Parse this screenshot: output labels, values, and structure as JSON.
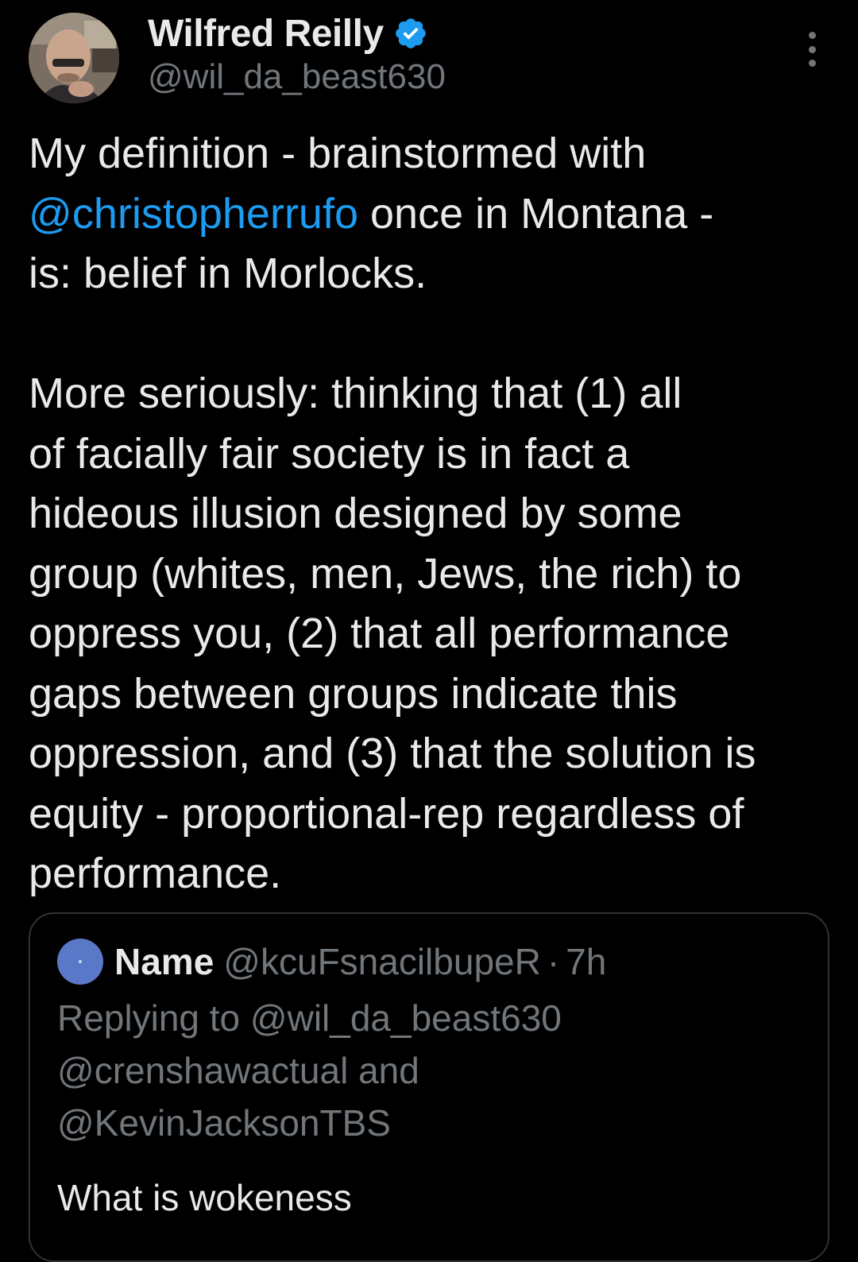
{
  "author": {
    "name": "Wilfred Reilly",
    "handle": "@wil_da_beast630",
    "verified": true,
    "avatar_icon": "profile-photo"
  },
  "more_icon": "more-vertical-icon",
  "tweet": {
    "line1": "My definition - brainstormed with",
    "mention": "@christopherrufo",
    "line2_rest": " once in Montana -",
    "line3": "is: belief in Morlocks.",
    "para2": [
      "More seriously: thinking that (1) all",
      "of facially fair society is in fact a",
      "hideous illusion designed by some",
      "group (whites, men, Jews, the rich) to",
      "oppress you, (2) that all performance",
      "gaps between groups indicate this",
      "oppression, and (3) that the solution is",
      "equity - proportional-rep regardless of",
      "performance."
    ]
  },
  "quote": {
    "name": "Name",
    "handle": "@kcuFsnacilbupeR",
    "separator": "·",
    "time": "7h",
    "reply_lines": [
      "Replying to @wil_da_beast630",
      "@crenshawactual and",
      "@KevinJacksonTBS"
    ],
    "text": "What is wokeness"
  },
  "colors": {
    "background": "#000000",
    "text": "#e7e9ea",
    "secondary": "#71767b",
    "link": "#1d9bf0",
    "border": "#2f3336"
  }
}
